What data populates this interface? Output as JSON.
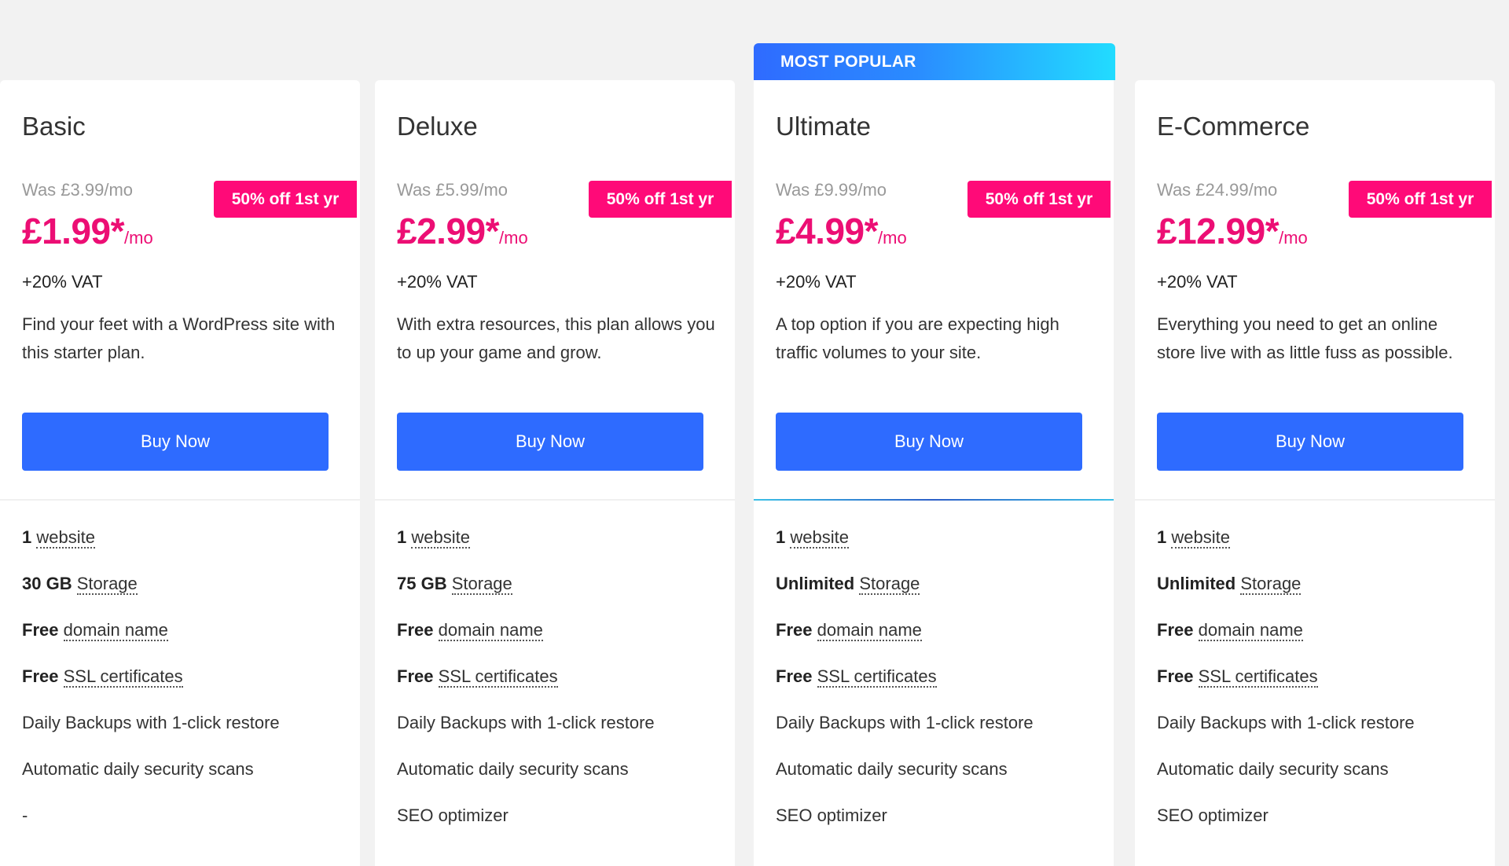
{
  "most_popular_label": "MOST POPULAR",
  "colors": {
    "accent": "#2e6bff",
    "badge": "#ff0a78",
    "price": "#ec0e74"
  },
  "plans": [
    {
      "name": "Basic",
      "was": "Was £3.99/mo",
      "badge": "50% off 1st yr",
      "price": "£1.99*",
      "per": "/mo",
      "vat": "+20% VAT",
      "desc": "Find your feet with a WordPress site with this starter plan.",
      "buy": "Buy Now",
      "features": [
        {
          "b": "1",
          "t": "website"
        },
        {
          "b": "30 GB",
          "t": "Storage"
        },
        {
          "b": "Free",
          "t": "domain name"
        },
        {
          "b": "Free",
          "t": "SSL certificates"
        },
        {
          "p": "Daily Backups with 1-click restore"
        },
        {
          "p": "Automatic daily security scans"
        },
        {
          "p": "-"
        }
      ]
    },
    {
      "name": "Deluxe",
      "was": "Was £5.99/mo",
      "badge": "50% off 1st yr",
      "price": "£2.99*",
      "per": "/mo",
      "vat": "+20% VAT",
      "desc": "With extra resources, this plan allows you to up your game and grow.",
      "buy": "Buy Now",
      "features": [
        {
          "b": "1",
          "t": "website"
        },
        {
          "b": "75 GB",
          "t": "Storage"
        },
        {
          "b": "Free",
          "t": "domain name"
        },
        {
          "b": "Free",
          "t": "SSL certificates"
        },
        {
          "p": "Daily Backups with 1-click restore"
        },
        {
          "p": "Automatic daily security scans"
        },
        {
          "p": "SEO optimizer"
        }
      ]
    },
    {
      "name": "Ultimate",
      "was": "Was £9.99/mo",
      "badge": "50% off 1st yr",
      "price": "£4.99*",
      "per": "/mo",
      "vat": "+20% VAT",
      "desc": "A top option if you are expecting high traffic volumes to your site.",
      "buy": "Buy Now",
      "features": [
        {
          "b": "1",
          "t": "website"
        },
        {
          "b": "Unlimited",
          "t": "Storage"
        },
        {
          "b": "Free",
          "t": "domain name"
        },
        {
          "b": "Free",
          "t": "SSL certificates"
        },
        {
          "p": "Daily Backups with 1-click restore"
        },
        {
          "p": "Automatic daily security scans"
        },
        {
          "p": "SEO optimizer"
        }
      ]
    },
    {
      "name": "E-Commerce",
      "was": "Was £24.99/mo",
      "badge": "50% off 1st yr",
      "price": "£12.99*",
      "per": "/mo",
      "vat": "+20% VAT",
      "desc": "Everything you need to get an online store live with as little fuss as possible.",
      "buy": "Buy Now",
      "features": [
        {
          "b": "1",
          "t": "website"
        },
        {
          "b": "Unlimited",
          "t": "Storage"
        },
        {
          "b": "Free",
          "t": "domain name"
        },
        {
          "b": "Free",
          "t": "SSL certificates"
        },
        {
          "p": "Daily Backups with 1-click restore"
        },
        {
          "p": "Automatic daily security scans"
        },
        {
          "p": "SEO optimizer"
        }
      ]
    }
  ]
}
